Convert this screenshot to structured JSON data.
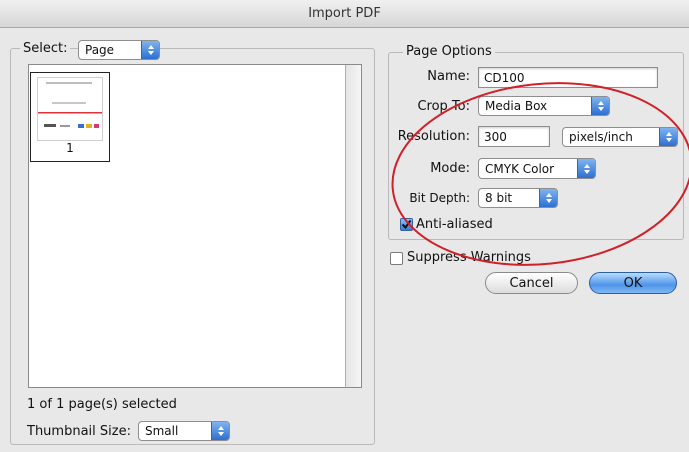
{
  "window": {
    "title": "Import PDF"
  },
  "left_panel": {
    "select_label": "Select:",
    "select_value": "Page",
    "thumbnail_page_number": "1",
    "selection_status": "1 of 1 page(s) selected",
    "thumbnail_size_label": "Thumbnail Size:",
    "thumbnail_size_value": "Small"
  },
  "page_options": {
    "legend": "Page Options",
    "name_label": "Name:",
    "name_value": "CD100",
    "crop_label": "Crop To:",
    "crop_value": "Media Box",
    "resolution_label": "Resolution:",
    "resolution_value": "300",
    "resolution_unit": "pixels/inch",
    "mode_label": "Mode:",
    "mode_value": "CMYK Color",
    "bit_depth_label": "Bit Depth:",
    "bit_depth_value": "8 bit",
    "anti_aliased_label": "Anti-aliased",
    "anti_aliased_checked": true
  },
  "suppress_warnings": {
    "label": "Suppress Warnings",
    "checked": false
  },
  "buttons": {
    "cancel": "Cancel",
    "ok": "OK"
  },
  "colors": {
    "annotation_circle": "#d0202a",
    "popup_accent": "#2d6fd1",
    "thumb_line": "#e0303a"
  },
  "icons": {
    "popup_arrows": "updown-arrows-icon",
    "checkmark": "checkmark-icon"
  }
}
